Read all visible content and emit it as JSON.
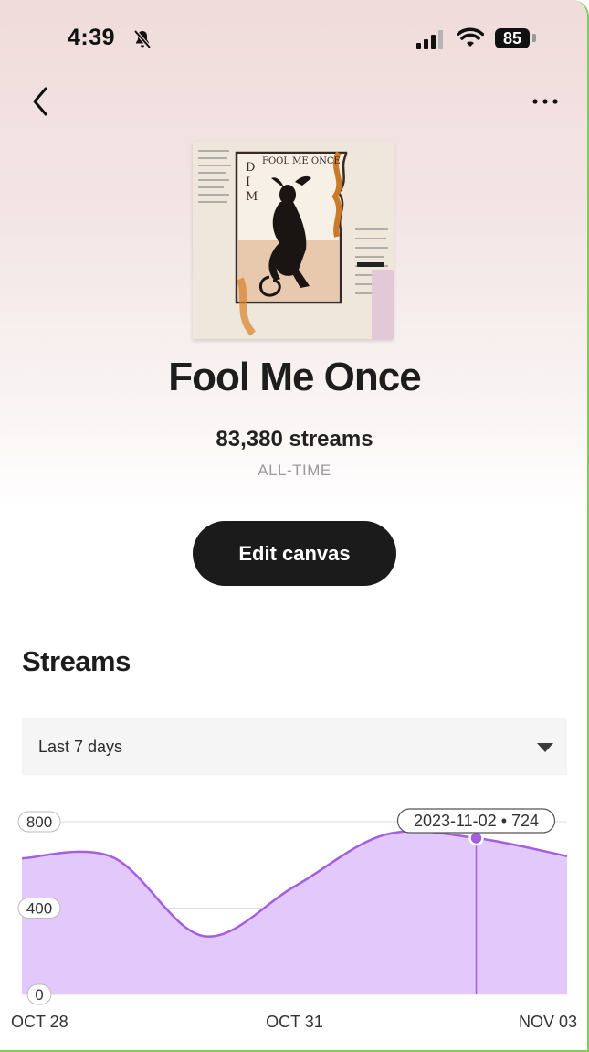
{
  "status_bar": {
    "time": "4:39",
    "battery": "85",
    "icons": [
      "bell-slash-icon",
      "signal-icon",
      "wifi-icon",
      "battery-icon"
    ]
  },
  "nav": {
    "back_icon": "chevron-left-icon",
    "more_icon": "ellipsis-icon"
  },
  "song": {
    "title": "Fool Me Once",
    "streams": "83,380 streams",
    "period_label": "ALL-TIME"
  },
  "actions": {
    "edit_canvas_label": "Edit canvas"
  },
  "streams_section": {
    "heading": "Streams",
    "period_selected": "Last 7 days"
  },
  "colors": {
    "accent": "#a35fe0",
    "chart_fill": "#e3c9fb",
    "button_bg": "#1b1b1b"
  },
  "chart_data": {
    "type": "area",
    "title": "",
    "xlabel": "",
    "ylabel": "",
    "x": [
      "2023-10-28",
      "2023-10-29",
      "2023-10-30",
      "2023-10-31",
      "2023-11-01",
      "2023-11-02",
      "2023-11-03"
    ],
    "x_tick_labels": [
      "OCT 28",
      "OCT 31",
      "NOV 03"
    ],
    "x_tick_index": [
      0,
      3,
      6
    ],
    "values": [
      630,
      635,
      270,
      500,
      740,
      724,
      640
    ],
    "ylim": [
      0,
      800
    ],
    "y_ticks": [
      "0",
      "400",
      "800"
    ],
    "y_tick_values": [
      0,
      400,
      800
    ],
    "grid": true,
    "highlight": {
      "index": 5,
      "label": "2023-11-02 • 724"
    }
  }
}
